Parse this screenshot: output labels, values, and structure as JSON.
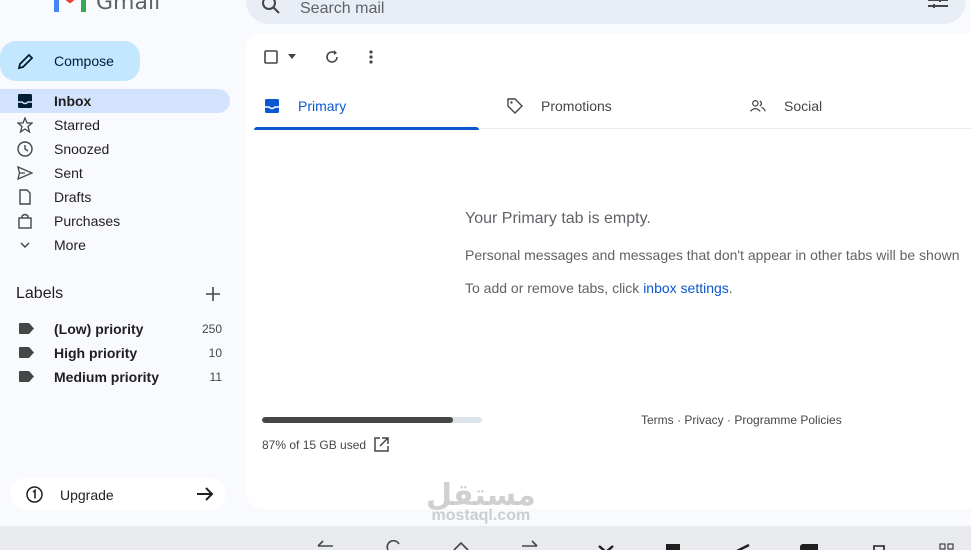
{
  "app": {
    "logo_text": "Gmail",
    "search_placeholder": "Search mail"
  },
  "compose": {
    "label": "Compose"
  },
  "nav": {
    "items": [
      {
        "label": "Inbox",
        "icon": "inbox-icon",
        "active": true
      },
      {
        "label": "Starred",
        "icon": "star-icon"
      },
      {
        "label": "Snoozed",
        "icon": "clock-icon"
      },
      {
        "label": "Sent",
        "icon": "send-icon"
      },
      {
        "label": "Drafts",
        "icon": "draft-icon"
      },
      {
        "label": "Purchases",
        "icon": "shopping-bag-icon"
      },
      {
        "label": "More",
        "icon": "chevron-down-icon"
      }
    ]
  },
  "labels": {
    "title": "Labels",
    "items": [
      {
        "name": "(Low) priority",
        "count": "250"
      },
      {
        "name": "High priority",
        "count": "10"
      },
      {
        "name": "Medium priority",
        "count": "11"
      }
    ]
  },
  "upgrade": {
    "label": "Upgrade"
  },
  "tabs": [
    {
      "label": "Primary",
      "icon": "inbox-tab-icon",
      "active": true
    },
    {
      "label": "Promotions",
      "icon": "tag-icon"
    },
    {
      "label": "Social",
      "icon": "people-icon"
    }
  ],
  "empty_state": {
    "heading": "Your Primary tab is empty.",
    "line1": "Personal messages and messages that don't appear in other tabs will be shown",
    "line2_prefix": "To add or remove tabs, click ",
    "line2_link": "inbox settings",
    "line2_suffix": "."
  },
  "storage": {
    "used_fraction": 0.87,
    "text": "87% of 15 GB used"
  },
  "footer": {
    "terms": "Terms",
    "privacy": "Privacy",
    "policies": "Programme Policies",
    "sep": " · "
  },
  "watermark": {
    "arabic": "مستقل",
    "latin": "mostaql.com"
  },
  "colors": {
    "accent": "#0b57d0",
    "compose_bg": "#c2e7ff",
    "active_nav_bg": "#d3e3fd",
    "background": "#f8fafd"
  }
}
